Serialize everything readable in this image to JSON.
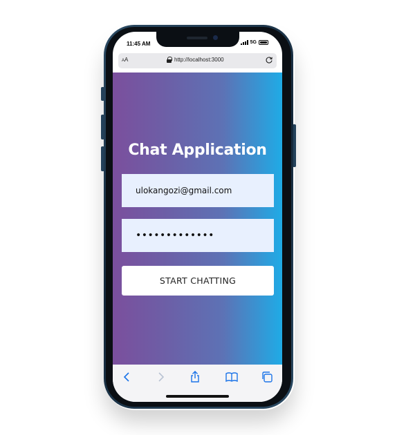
{
  "status_bar": {
    "time": "11:45 AM",
    "network": "5G"
  },
  "browser": {
    "aa_label_small": "A",
    "aa_label_large": "A",
    "url": "http://localhost:3000",
    "icons": {
      "lock": "lock-icon",
      "reload": "reload-icon",
      "back": "chevron-left-icon",
      "forward": "chevron-right-icon",
      "share": "share-icon",
      "bookmarks": "book-icon",
      "tabs": "tabs-icon"
    }
  },
  "app": {
    "title": "Chat Application",
    "email_value": "ulokangozi@gmail.com",
    "password_value": "•••••••••••••",
    "start_button_label": "START CHATTING",
    "colors": {
      "gradient_start": "#7b4f9d",
      "gradient_end": "#1fabe6",
      "input_bg": "#e8f0fe",
      "toolbar_accent": "#1a73e8"
    }
  }
}
